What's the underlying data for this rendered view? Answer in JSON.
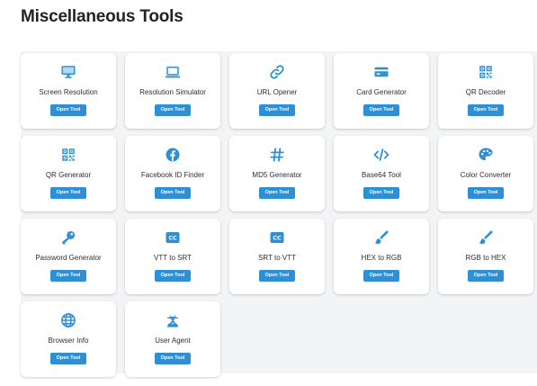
{
  "page": {
    "title": "Miscellaneous Tools"
  },
  "accent_color": "#2d8fd5",
  "tools": [
    {
      "label": "Screen Resolution",
      "icon": "monitor-icon",
      "button": "Open Tool"
    },
    {
      "label": "Resolution Simulator",
      "icon": "laptop-icon",
      "button": "Open Tool"
    },
    {
      "label": "URL Opener",
      "icon": "link-icon",
      "button": "Open Tool"
    },
    {
      "label": "Card Generator",
      "icon": "credit-card-icon",
      "button": "Open Tool"
    },
    {
      "label": "QR Decoder",
      "icon": "qrcode-icon",
      "button": "Open Tool"
    },
    {
      "label": "QR Generator",
      "icon": "qrcode-icon",
      "button": "Open Tool"
    },
    {
      "label": "Facebook ID Finder",
      "icon": "facebook-icon",
      "button": "Open Tool"
    },
    {
      "label": "MD5 Generator",
      "icon": "hashtag-icon",
      "button": "Open Tool"
    },
    {
      "label": "Base64 Tool",
      "icon": "code-icon",
      "button": "Open Tool"
    },
    {
      "label": "Color Converter",
      "icon": "palette-icon",
      "button": "Open Tool"
    },
    {
      "label": "Password Generator",
      "icon": "key-icon",
      "button": "Open Tool"
    },
    {
      "label": "VTT to SRT",
      "icon": "closed-captions-icon",
      "button": "Open Tool"
    },
    {
      "label": "SRT to VTT",
      "icon": "closed-captions-icon",
      "button": "Open Tool"
    },
    {
      "label": "HEX to RGB",
      "icon": "paintbrush-icon",
      "button": "Open Tool"
    },
    {
      "label": "RGB to HEX",
      "icon": "paintbrush-icon",
      "button": "Open Tool"
    },
    {
      "label": "Browser Info",
      "icon": "globe-icon",
      "button": "Open Tool"
    },
    {
      "label": "User Agent",
      "icon": "user-secret-icon",
      "button": "Open Tool"
    }
  ]
}
